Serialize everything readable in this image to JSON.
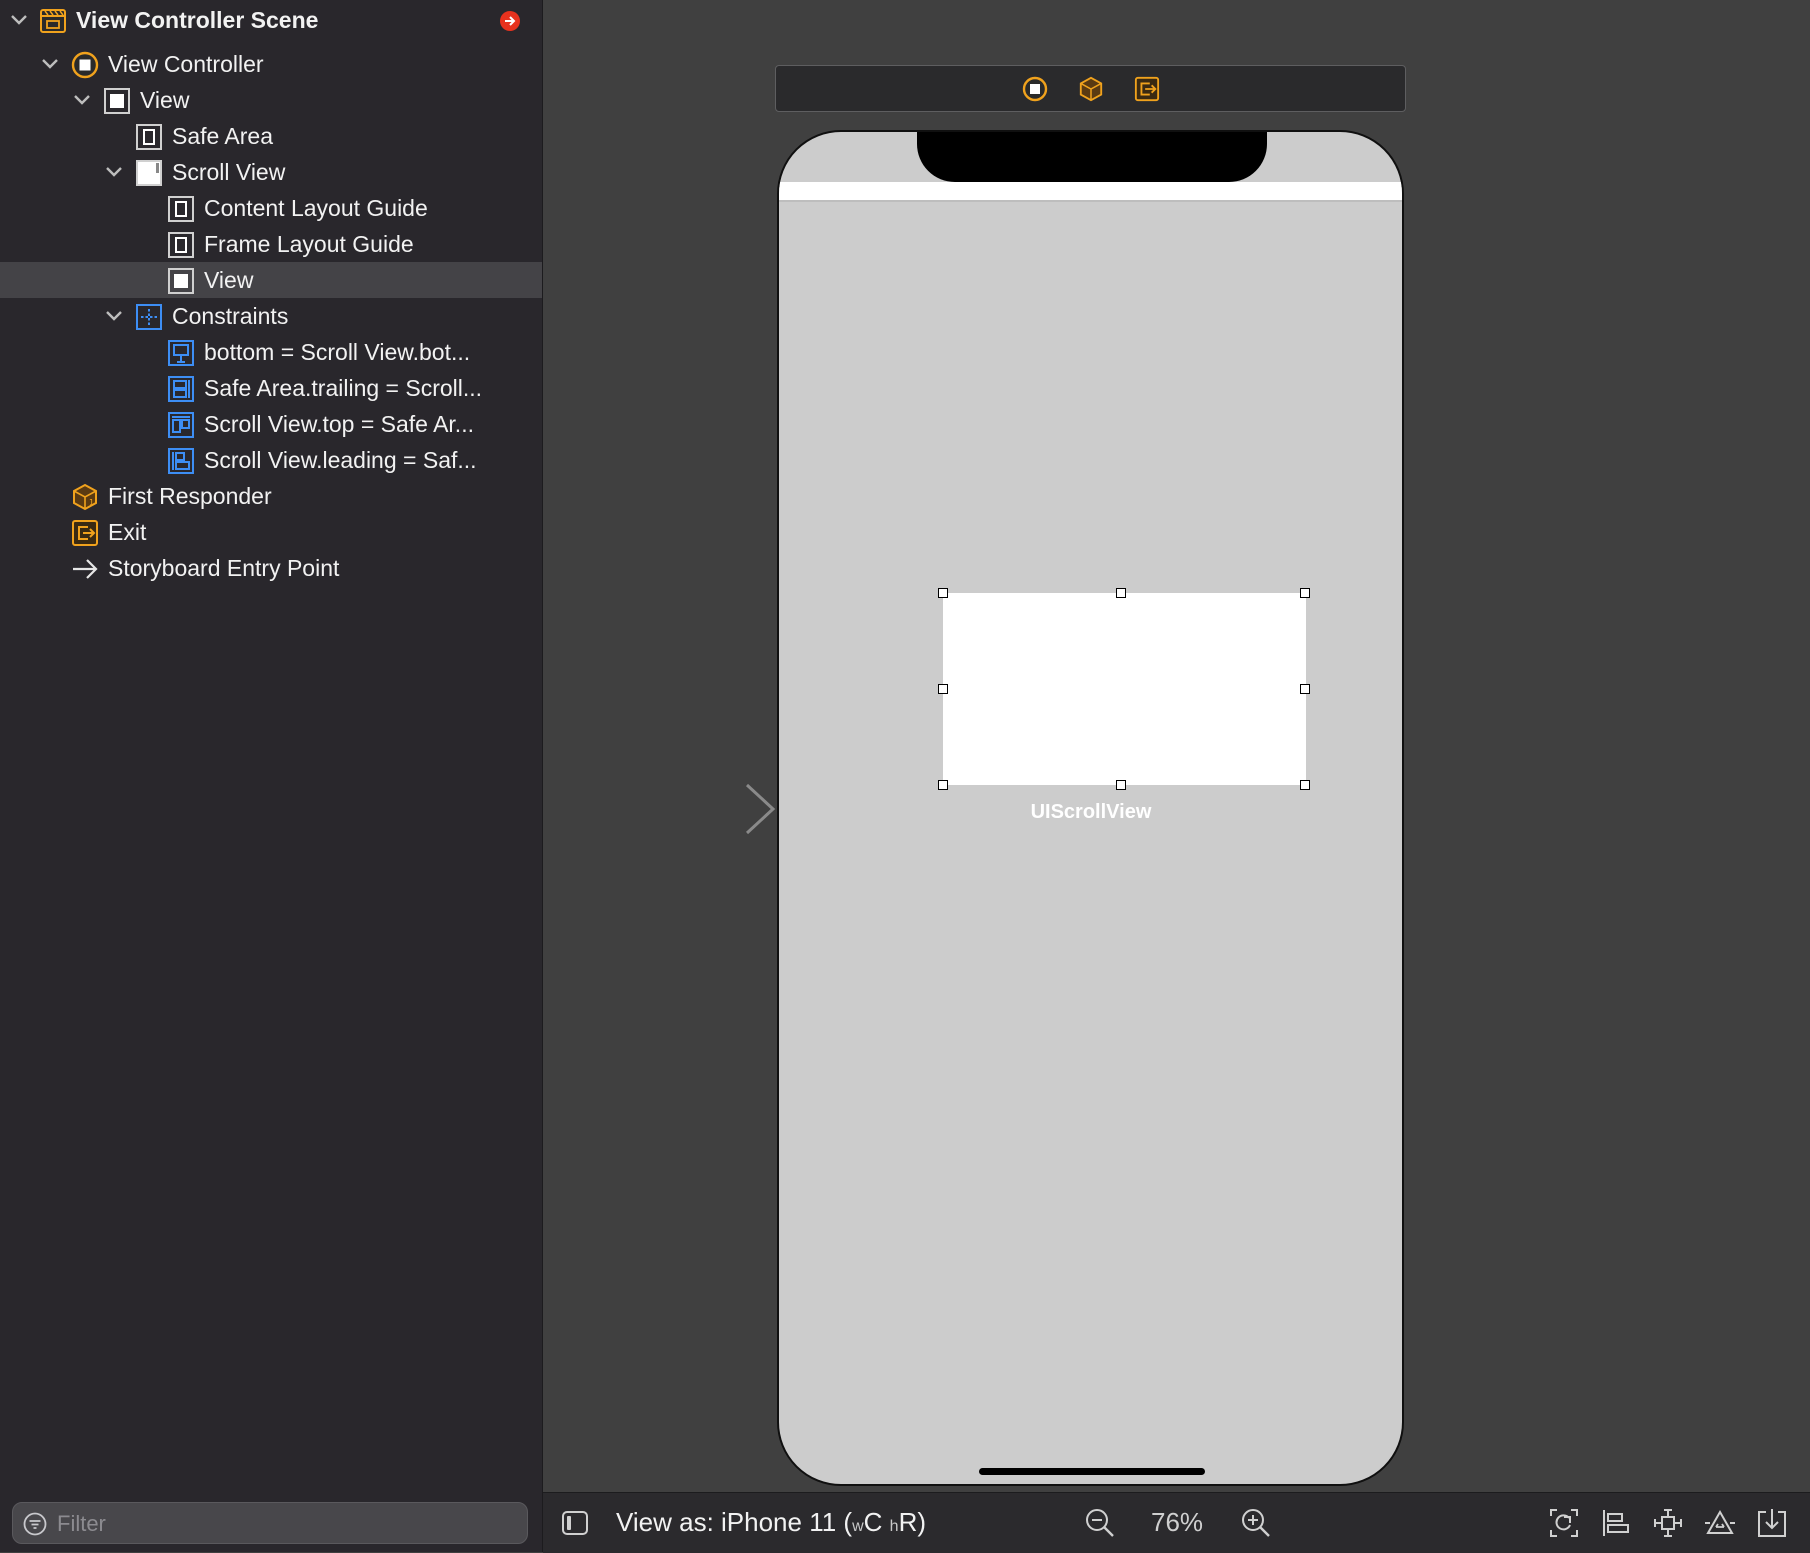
{
  "outline": {
    "rows": [
      {
        "label": "View Controller Scene",
        "indent": 0,
        "expanded": true,
        "icon": "scene-icon"
      },
      {
        "label": "View Controller",
        "indent": 1,
        "expanded": true,
        "icon": "view-controller-icon"
      },
      {
        "label": "View",
        "indent": 2,
        "expanded": true,
        "icon": "view-icon"
      },
      {
        "label": "Safe Area",
        "indent": 3,
        "icon": "layout-guide-icon"
      },
      {
        "label": "Scroll View",
        "indent": 3,
        "expanded": true,
        "icon": "scroll-view-icon"
      },
      {
        "label": "Content Layout Guide",
        "indent": 4,
        "icon": "layout-guide-icon"
      },
      {
        "label": "Frame Layout Guide",
        "indent": 4,
        "icon": "layout-guide-icon"
      },
      {
        "label": "View",
        "indent": 4,
        "icon": "view-icon",
        "selected": true
      },
      {
        "label": "Constraints",
        "indent": 3,
        "expanded": true,
        "icon": "constraints-icon"
      },
      {
        "label": "bottom = Scroll View.bot...",
        "indent": 4,
        "icon": "constraint-icon"
      },
      {
        "label": "Safe Area.trailing = Scroll...",
        "indent": 4,
        "icon": "constraint-icon"
      },
      {
        "label": "Scroll View.top = Safe Ar...",
        "indent": 4,
        "icon": "constraint-icon"
      },
      {
        "label": "Scroll View.leading = Saf...",
        "indent": 4,
        "icon": "constraint-icon"
      },
      {
        "label": "First Responder",
        "indent": 1,
        "icon": "first-responder-icon"
      },
      {
        "label": "Exit",
        "indent": 1,
        "icon": "exit-icon"
      },
      {
        "label": "Storyboard Entry Point",
        "indent": 1,
        "icon": "entry-arrow-icon"
      }
    ],
    "filter_placeholder": "Filter"
  },
  "canvas": {
    "scroll_view_label": "UIScrollView"
  },
  "bottombar": {
    "view_as_prefix": "View as: iPhone 11 (",
    "w_small": "w",
    "w_class": "C",
    "h_small": "h",
    "h_class": "R",
    "view_as_suffix": ")",
    "zoom": "76%"
  },
  "colors": {
    "sidebar_bg": "#29272c",
    "canvas_bg": "#404040",
    "selection": "#444347",
    "accent_orange": "#f0a21d",
    "constraint_blue": "#3d8ef5",
    "error_red": "#e8321e"
  }
}
